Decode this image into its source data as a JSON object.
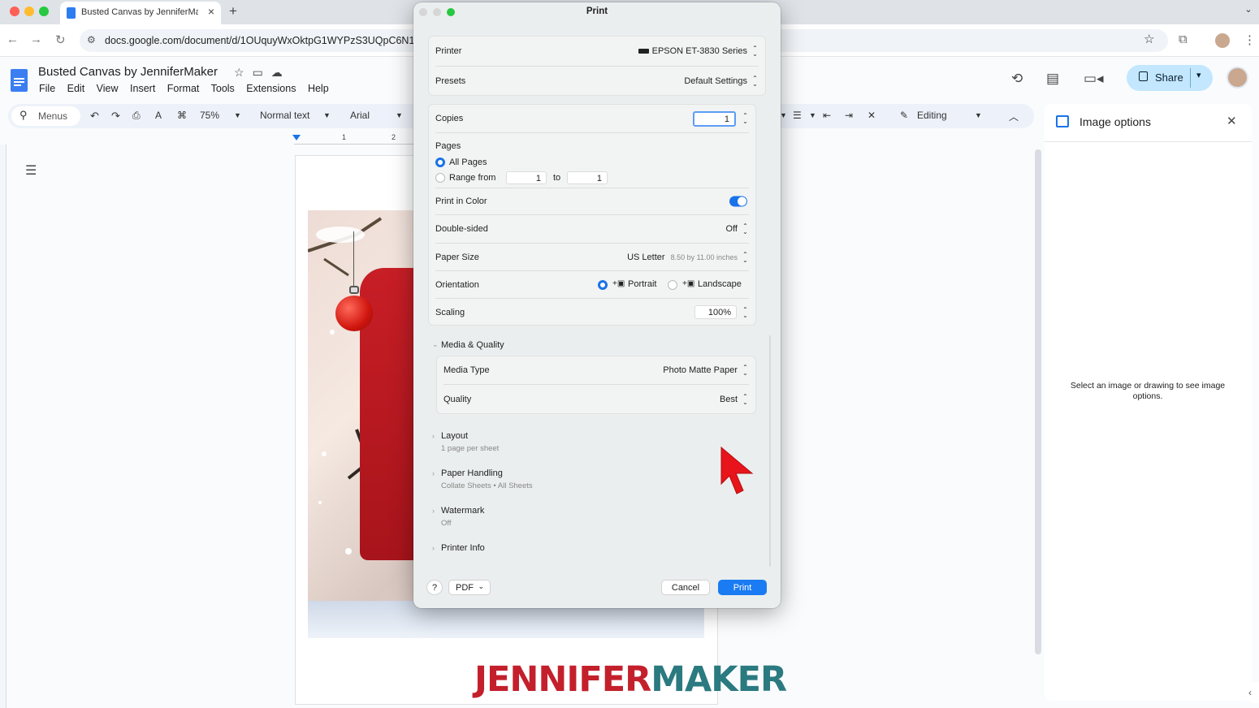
{
  "browser": {
    "tab_title": "Busted Canvas by JenniferMaker",
    "url": "docs.google.com/document/d/1OUquyWxOktpG1WYPzS3UQpC6N1"
  },
  "docs": {
    "title": "Busted Canvas by JenniferMaker",
    "menu": [
      "File",
      "Edit",
      "View",
      "Insert",
      "Format",
      "Tools",
      "Extensions",
      "Help"
    ],
    "share_label": "Share",
    "toolbar": {
      "search_label": "Menus",
      "zoom": "75%",
      "style": "Normal text",
      "font": "Arial",
      "mode": "Editing"
    },
    "ruler_marks": [
      "1",
      "2"
    ],
    "watermark_logo": "JENNIFERMAKER",
    "image_options": {
      "title": "Image options",
      "message": "Select an image or drawing to see image options."
    }
  },
  "print_dialog": {
    "title": "Print",
    "printer_label": "Printer",
    "printer_value": "EPSON ET-3830 Series",
    "presets_label": "Presets",
    "presets_value": "Default Settings",
    "copies_label": "Copies",
    "copies_value": "1",
    "pages_label": "Pages",
    "all_pages_label": "All Pages",
    "range_from_label": "Range from",
    "range_from_value": "1",
    "range_to_label": "to",
    "range_to_value": "1",
    "print_in_color_label": "Print in Color",
    "print_in_color": true,
    "double_sided_label": "Double-sided",
    "double_sided_value": "Off",
    "paper_size_label": "Paper Size",
    "paper_size_value": "US Letter",
    "paper_size_detail": "8.50 by 11.00 inches",
    "orientation_label": "Orientation",
    "portrait_label": "Portrait",
    "landscape_label": "Landscape",
    "scaling_label": "Scaling",
    "scaling_value": "100%",
    "media_quality_label": "Media & Quality",
    "media_type_label": "Media Type",
    "media_type_value": "Photo Matte Paper",
    "quality_label": "Quality",
    "quality_value": "Best",
    "layout_label": "Layout",
    "layout_sub": "1 page per sheet",
    "paper_handling_label": "Paper Handling",
    "paper_handling_sub": "Collate Sheets • All Sheets",
    "watermark_label": "Watermark",
    "watermark_sub": "Off",
    "printer_info_label": "Printer Info",
    "help_label": "?",
    "pdf_label": "PDF",
    "cancel_label": "Cancel",
    "print_label": "Print"
  },
  "colors": {
    "accent": "#1a73e8",
    "share_bg": "#c2e7ff",
    "logo_red": "#c3202c",
    "logo_teal": "#2a7a80"
  }
}
